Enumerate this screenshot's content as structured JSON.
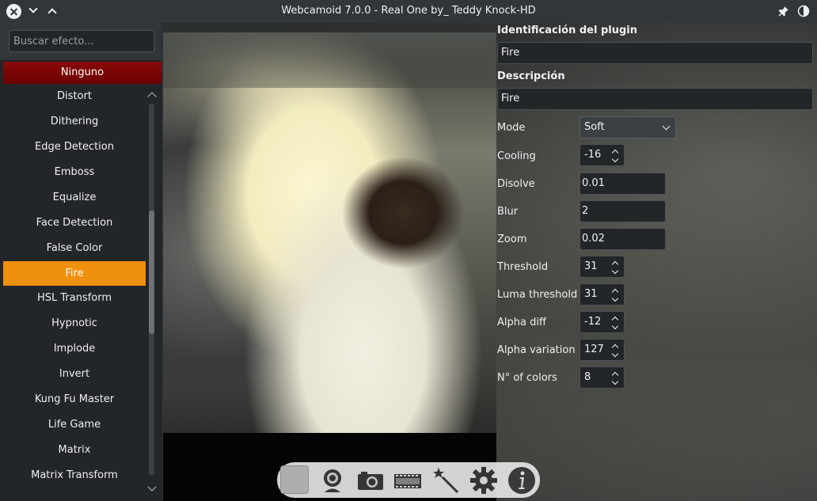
{
  "window": {
    "title": "Webcamoid 7.0.0 - Real One by_ Teddy Knock-HD"
  },
  "sidebar": {
    "search_placeholder": "Buscar efecto...",
    "none_label": "Ninguno",
    "items": [
      {
        "label": "Distort"
      },
      {
        "label": "Dithering"
      },
      {
        "label": "Edge Detection"
      },
      {
        "label": "Emboss"
      },
      {
        "label": "Equalize"
      },
      {
        "label": "Face Detection"
      },
      {
        "label": "False Color"
      },
      {
        "label": "Fire"
      },
      {
        "label": "HSL Transform"
      },
      {
        "label": "Hypnotic"
      },
      {
        "label": "Implode"
      },
      {
        "label": "Invert"
      },
      {
        "label": "Kung Fu Master"
      },
      {
        "label": "Life Game"
      },
      {
        "label": "Matrix"
      },
      {
        "label": "Matrix Transform"
      }
    ],
    "selected_item": "Fire"
  },
  "panel": {
    "plugin_id_label": "Identificación del plugin",
    "plugin_id_value": "Fire",
    "description_label": "Descripción",
    "description_value": "Fire",
    "params": {
      "mode": {
        "label": "Mode",
        "value": "Soft"
      },
      "cooling": {
        "label": "Cooling",
        "value": "-16"
      },
      "disolve": {
        "label": "Disolve",
        "value": "0.01"
      },
      "blur": {
        "label": "Blur",
        "value": "2"
      },
      "zoom": {
        "label": "Zoom",
        "value": "0.02"
      },
      "threshold": {
        "label": "Threshold",
        "value": "31"
      },
      "luma_threshold": {
        "label": "Luma threshold",
        "value": "31"
      },
      "alpha_diff": {
        "label": "Alpha diff",
        "value": "-12"
      },
      "alpha_variation": {
        "label": "Alpha variation",
        "value": "127"
      },
      "n_colors": {
        "label": "N° of colors",
        "value": "8"
      }
    }
  },
  "toolbar": {
    "icons": [
      "stop-icon",
      "webcam-icon",
      "camera-icon",
      "film-icon",
      "magic-wand-icon",
      "gear-icon",
      "info-icon"
    ]
  },
  "colors": {
    "accent_selected": "#f0900f",
    "none_item": "#7a0000",
    "window_bg": "#31363b"
  }
}
